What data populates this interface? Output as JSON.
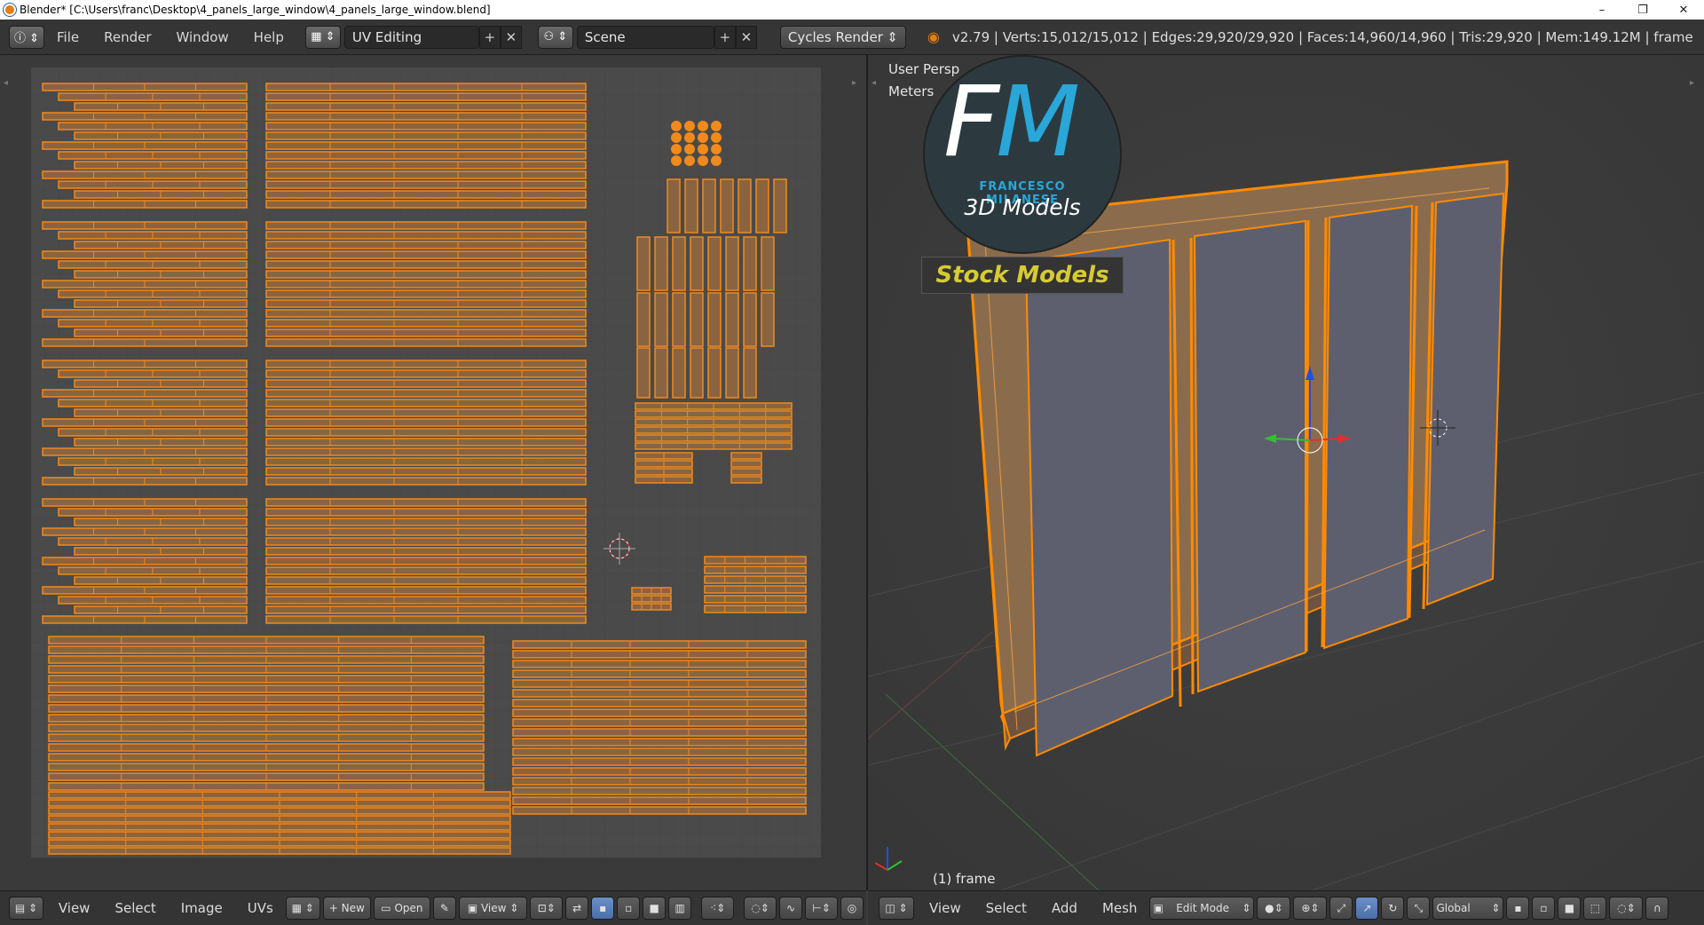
{
  "window": {
    "title": "Blender* [C:\\Users\\franc\\Desktop\\4_panels_large_window\\4_panels_large_window.blend]",
    "controls": [
      "–",
      "❐",
      "✕"
    ]
  },
  "infobar": {
    "menus": [
      "File",
      "Render",
      "Window",
      "Help"
    ],
    "screen_layout": "UV Editing",
    "scene": "Scene",
    "render_engine": "Cycles Render",
    "stats": "v2.79 | Verts:15,012/15,012 | Edges:29,920/29,920 | Faces:14,960/14,960 | Tris:29,920 | Mem:149.12M | frame"
  },
  "uv_editor": {
    "footer_menus": [
      "View",
      "Select",
      "Image",
      "UVs"
    ],
    "new_label": "New",
    "open_label": "Open",
    "view_label": "View"
  },
  "viewport": {
    "view_name": "User Persp",
    "units": "Meters",
    "object_label": "(1) frame",
    "footer_menus": [
      "View",
      "Select",
      "Add",
      "Mesh"
    ],
    "mode": "Edit Mode",
    "orientation": "Global"
  },
  "watermark": {
    "logo_f": "F",
    "logo_m": "M",
    "brand": "FRANCESCO MILANESE",
    "tagline": "3D Models",
    "stock": "Stock Models"
  },
  "colors": {
    "uv_orange": "#f08a1c",
    "uv_fill": "#8a6440",
    "accent_blue": "#29a7d8",
    "stock_yellow": "#d7cb32"
  }
}
